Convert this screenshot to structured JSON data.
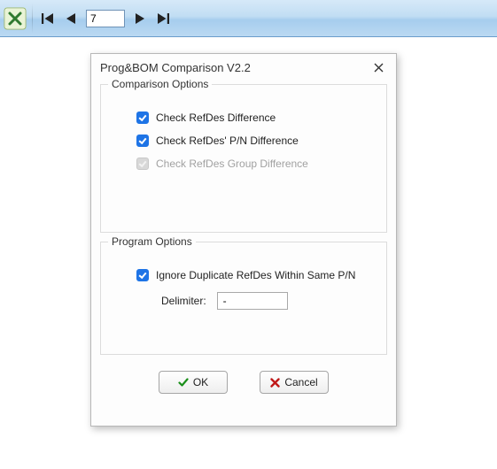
{
  "toolbar": {
    "page_value": "7"
  },
  "dialog": {
    "title": "Prog&BOM Comparison V2.2",
    "groups": {
      "comparison": {
        "title": "Comparison Options",
        "items": [
          {
            "label": "Check RefDes Difference",
            "checked": true,
            "enabled": true
          },
          {
            "label": "Check RefDes' P/N Difference",
            "checked": true,
            "enabled": true
          },
          {
            "label": "Check RefDes Group Difference",
            "checked": true,
            "enabled": false
          }
        ]
      },
      "program": {
        "title": "Program Options",
        "items": [
          {
            "label": "Ignore Duplicate RefDes Within Same P/N",
            "checked": true,
            "enabled": true
          }
        ],
        "delimiter_label": "Delimiter:",
        "delimiter_value": "-"
      }
    },
    "buttons": {
      "ok": "OK",
      "cancel": "Cancel"
    }
  }
}
